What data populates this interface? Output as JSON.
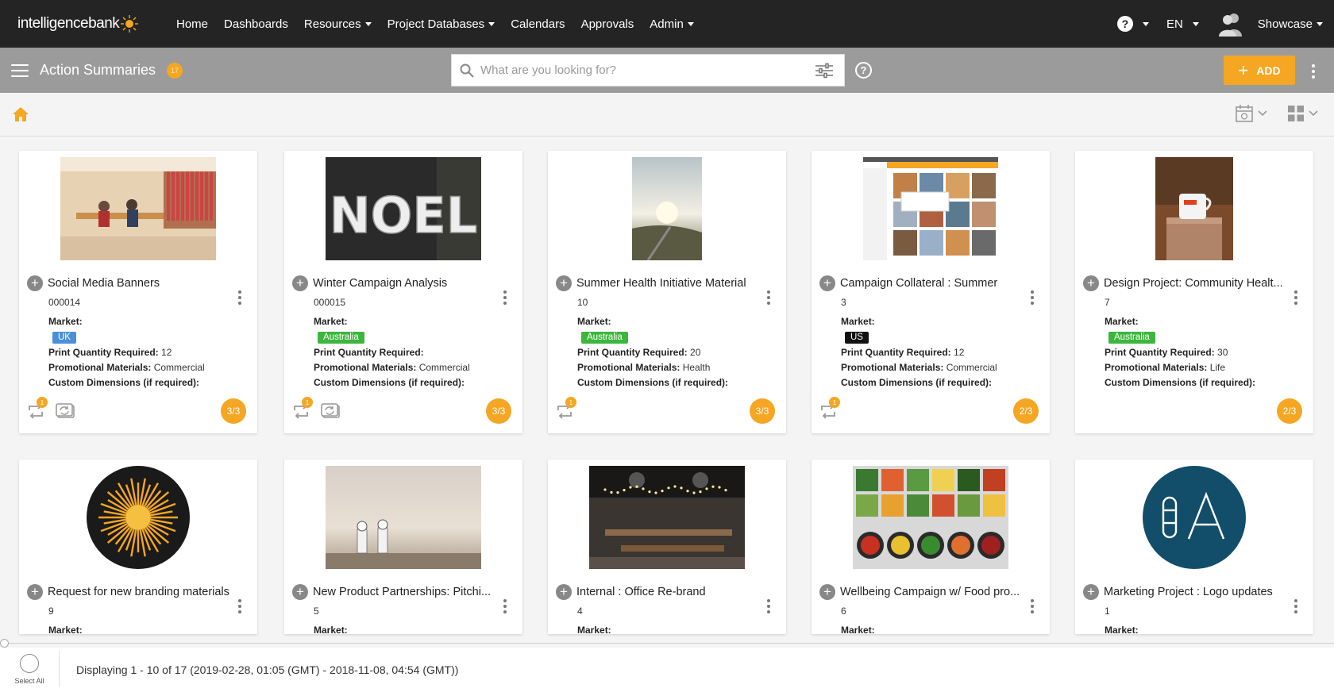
{
  "app": {
    "logo_text": "intelligencebank"
  },
  "nav": {
    "links": [
      {
        "label": "Home",
        "dropdown": false
      },
      {
        "label": "Dashboards",
        "dropdown": false
      },
      {
        "label": "Resources",
        "dropdown": true
      },
      {
        "label": "Project Databases",
        "dropdown": true
      },
      {
        "label": "Calendars",
        "dropdown": false
      },
      {
        "label": "Approvals",
        "dropdown": false
      },
      {
        "label": "Admin",
        "dropdown": true
      }
    ],
    "help_icon": "question-circle-icon",
    "language": "EN",
    "user": "Showcase"
  },
  "header": {
    "title": "Action Summaries",
    "count": "17",
    "search_placeholder": "What are you looking for?",
    "add_label": "ADD"
  },
  "colors": {
    "accent": "#f5a623",
    "tag_uk": "#4a90d9",
    "tag_australia": "#3cb63c",
    "tag_us": "#111111"
  },
  "cards": [
    {
      "title": "Social Media Banners",
      "id": "000014",
      "market": "UK",
      "market_color": "#4a90d9",
      "print_qty": "12",
      "promo": "Commercial",
      "custom": "",
      "progress": "3/3",
      "loop_badge": "1",
      "extra_icon": true
    },
    {
      "title": "Winter Campaign Analysis",
      "id": "000015",
      "market": "Australia",
      "market_color": "#3cb63c",
      "print_qty": "",
      "promo": "Commercial",
      "custom": "",
      "progress": "3/3",
      "loop_badge": "1",
      "extra_icon": true
    },
    {
      "title": "Summer Health Initiative Material",
      "id": "10",
      "market": "Australia",
      "market_color": "#3cb63c",
      "print_qty": "20",
      "promo": "Health",
      "custom": "",
      "progress": "3/3",
      "loop_badge": "1",
      "extra_icon": false
    },
    {
      "title": "Campaign Collateral : Summer",
      "id": "3",
      "market": "US",
      "market_color": "#111111",
      "print_qty": "12",
      "promo": "Commercial",
      "custom": "",
      "progress": "2/3",
      "loop_badge": "1",
      "extra_icon": false
    },
    {
      "title": "Design Project: Community Healt...",
      "id": "7",
      "market": "Australia",
      "market_color": "#3cb63c",
      "print_qty": "30",
      "promo": "Life",
      "custom": "",
      "progress": "2/3",
      "loop_badge": "",
      "extra_icon": false
    },
    {
      "title": "Request for new branding materials",
      "id": "9"
    },
    {
      "title": "New Product Partnerships: Pitchi...",
      "id": "5"
    },
    {
      "title": "Internal : Office Re-brand",
      "id": "4"
    },
    {
      "title": "Wellbeing Campaign w/ Food pro...",
      "id": "6"
    },
    {
      "title": "Marketing Project : Logo updates",
      "id": "1"
    }
  ],
  "field_labels": {
    "market": "Market:",
    "print_qty": "Print Quantity Required:",
    "promo": "Promotional Materials:",
    "custom": "Custom Dimensions (if required):"
  },
  "footer": {
    "select_all": "Select All",
    "display_text": "Displaying 1 - 10 of 17 (2019-02-28, 01:05 (GMT) - 2018-11-08, 04:54 (GMT))"
  }
}
